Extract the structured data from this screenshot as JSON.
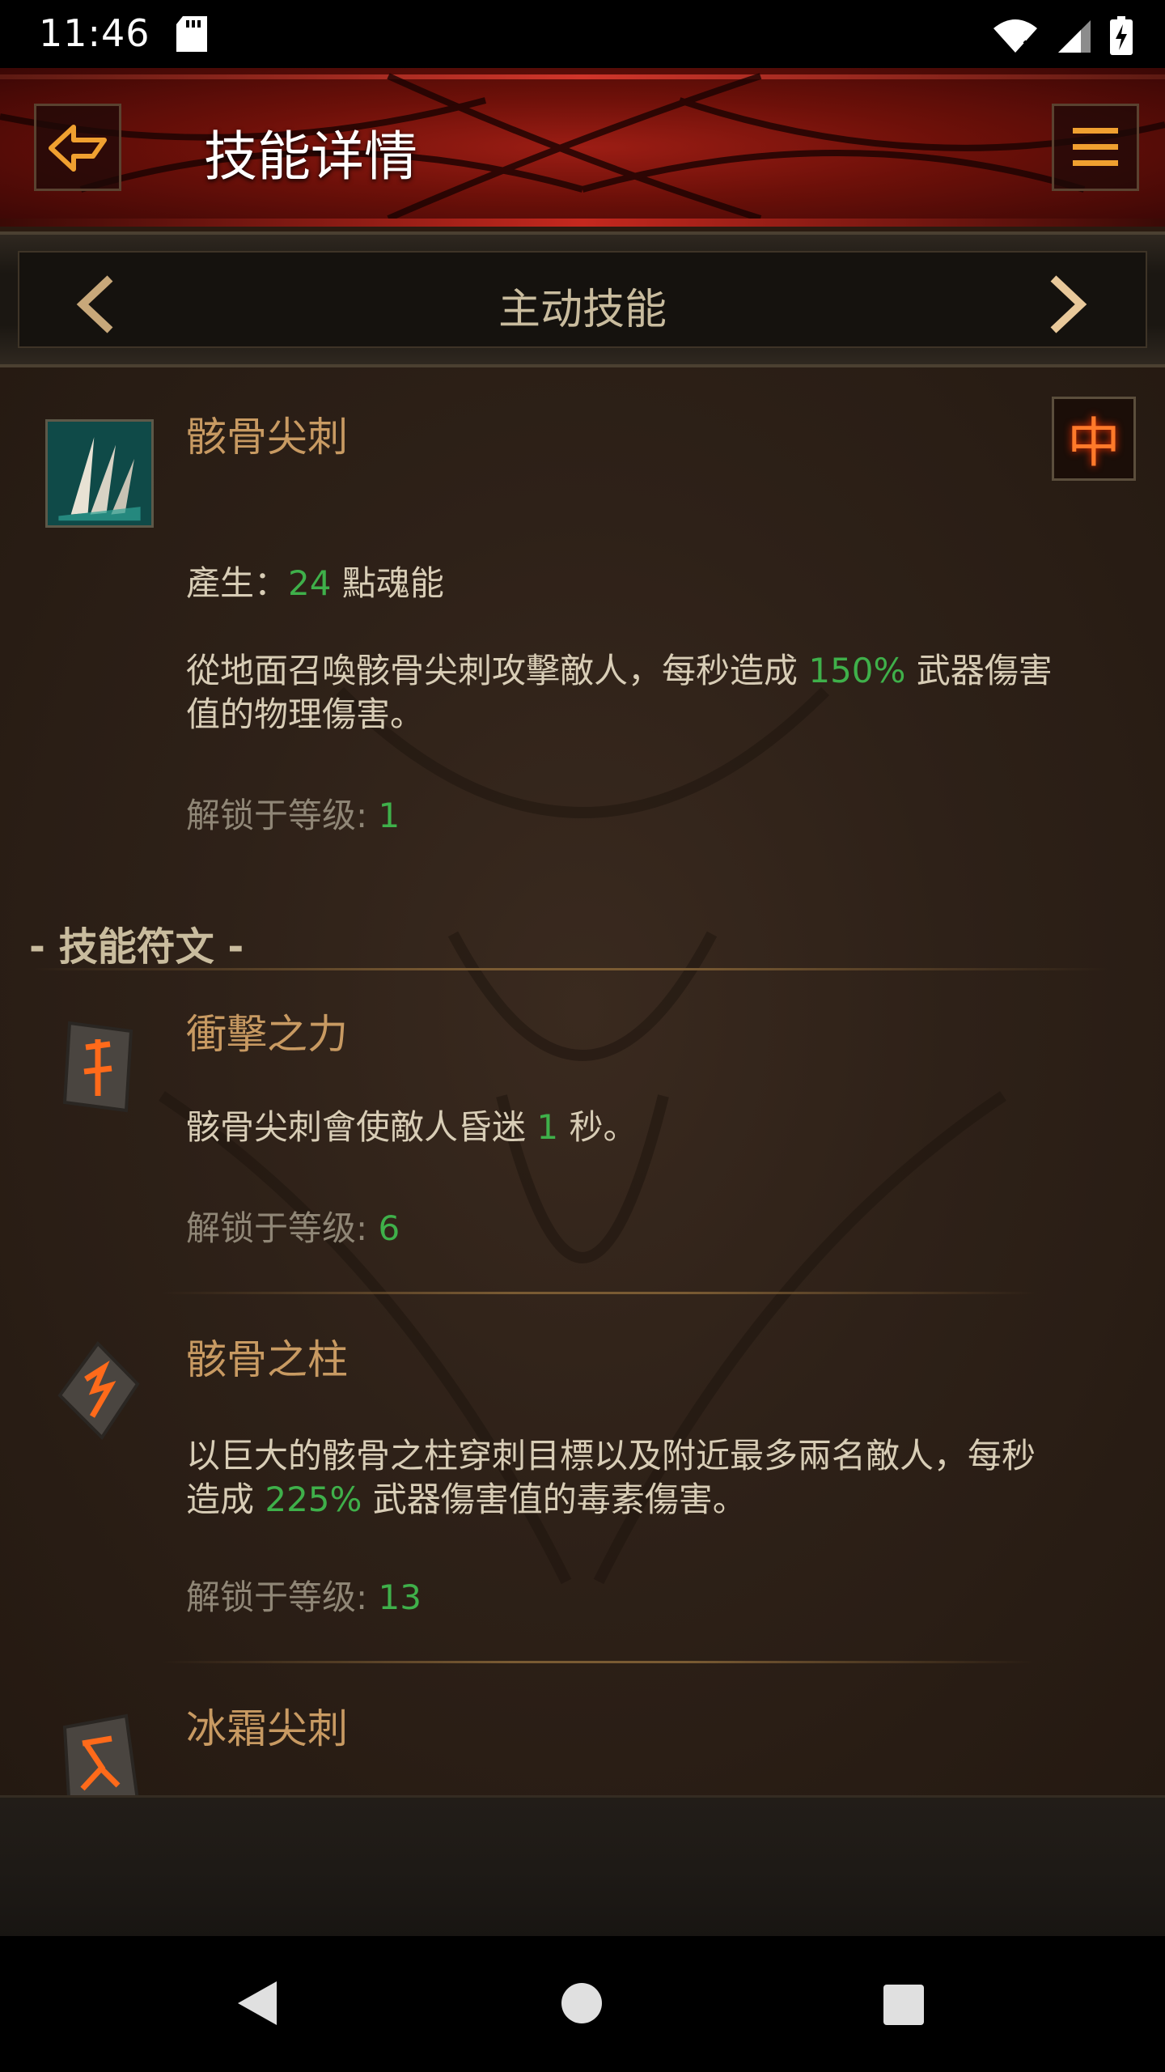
{
  "status_bar": {
    "time": "11:46"
  },
  "header": {
    "title": "技能详情"
  },
  "category": {
    "title": "主动技能"
  },
  "skill": {
    "name": "骸骨尖刺",
    "lang_button": "中",
    "generate_prefix": "產生：",
    "generate_value": "24",
    "generate_suffix": " 點魂能",
    "desc_line1_prefix": "從地面召喚骸骨尖刺攻擊敵人，每秒造成 ",
    "desc_line1_value": "150%",
    "desc_line1_suffix": " 武器傷害",
    "desc_line2": "值的物理傷害。",
    "unlock_label": "解锁于等级: ",
    "unlock_level": "1"
  },
  "runes_section": {
    "title": "- 技能符文 -"
  },
  "runes": [
    {
      "name": "衝擊之力",
      "desc_prefix": "骸骨尖刺會使敵人昏迷 ",
      "desc_value": "1",
      "desc_suffix": " 秒。",
      "unlock_label": "解锁于等级: ",
      "unlock_level": "6"
    },
    {
      "name": "骸骨之柱",
      "desc_line1": "以巨大的骸骨之柱穿刺目標以及附近最多兩名敵人，每秒",
      "desc_line2_prefix": "造成 ",
      "desc_value": "225%",
      "desc_line2_suffix": " 武器傷害值的毒素傷害。",
      "unlock_label": "解锁于等级: ",
      "unlock_level": "13"
    },
    {
      "name": "冰霜尖刺"
    }
  ],
  "colors": {
    "accent_green": "#3fb04a",
    "gold_text": "#c89a62",
    "body_text": "#d8cdb6"
  }
}
